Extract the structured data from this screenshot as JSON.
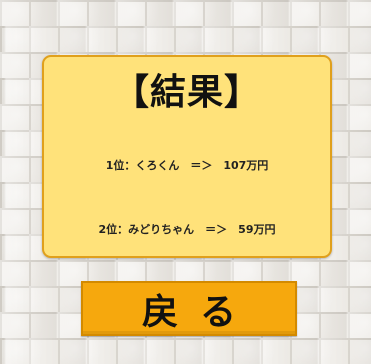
{
  "result": {
    "title": "【結果】",
    "rankings": [
      {
        "text": "1位：くろくん　＝＞　107万円"
      },
      {
        "text": "2位：みどりちゃん　＝＞　59万円"
      }
    ]
  },
  "controls": {
    "back_label": "戻る"
  },
  "colors": {
    "panel": "#ffe27a",
    "panel_border": "#e0a01c",
    "button": "#f6a80d"
  }
}
